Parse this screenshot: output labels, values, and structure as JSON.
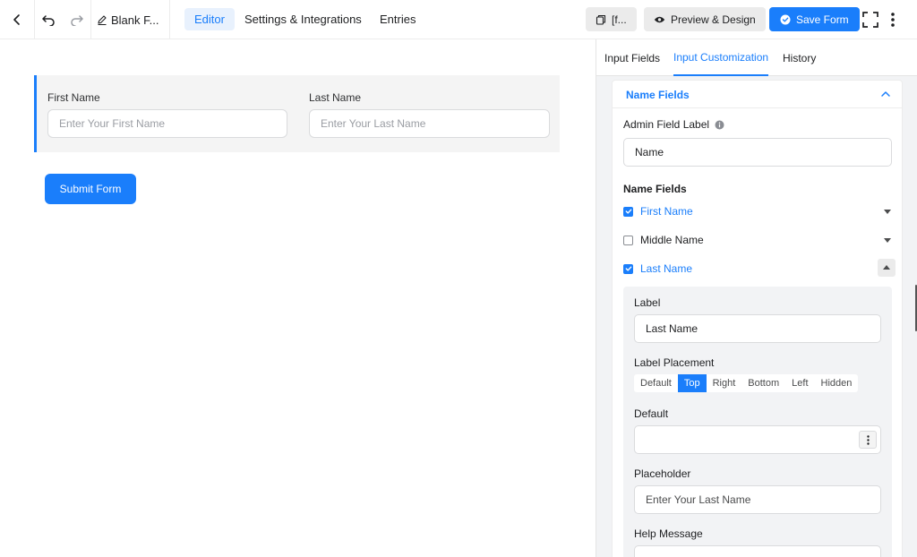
{
  "header": {
    "form_title": "Blank F...",
    "tabs": [
      "Editor",
      "Settings & Integrations",
      "Entries"
    ],
    "shortcode_label": "[f...",
    "preview_label": "Preview & Design",
    "save_label": "Save Form"
  },
  "form": {
    "first_name_label": "First Name",
    "first_name_placeholder": "Enter Your First Name",
    "last_name_label": "Last Name",
    "last_name_placeholder": "Enter Your Last Name",
    "submit_label": "Submit Form"
  },
  "panel": {
    "tabs": [
      "Input Fields",
      "Input Customization",
      "History"
    ],
    "section_title": "Name Fields",
    "admin_label_title": "Admin Field Label",
    "admin_label_value": "Name",
    "name_fields_title": "Name Fields",
    "fields": [
      {
        "label": "First Name",
        "checked": true
      },
      {
        "label": "Middle Name",
        "checked": false
      },
      {
        "label": "Last Name",
        "checked": true
      }
    ],
    "expanded": {
      "label_title": "Label",
      "label_value": "Last Name",
      "placement_title": "Label Placement",
      "placement_options": [
        "Default",
        "Top",
        "Right",
        "Bottom",
        "Left",
        "Hidden"
      ],
      "placement_selected": "Top",
      "default_title": "Default",
      "default_value": "",
      "placeholder_title": "Placeholder",
      "placeholder_value": "Enter Your Last Name",
      "help_title": "Help Message"
    }
  },
  "colors": {
    "accent": "#1a7efb",
    "panel_bg": "#f2f3f5"
  }
}
